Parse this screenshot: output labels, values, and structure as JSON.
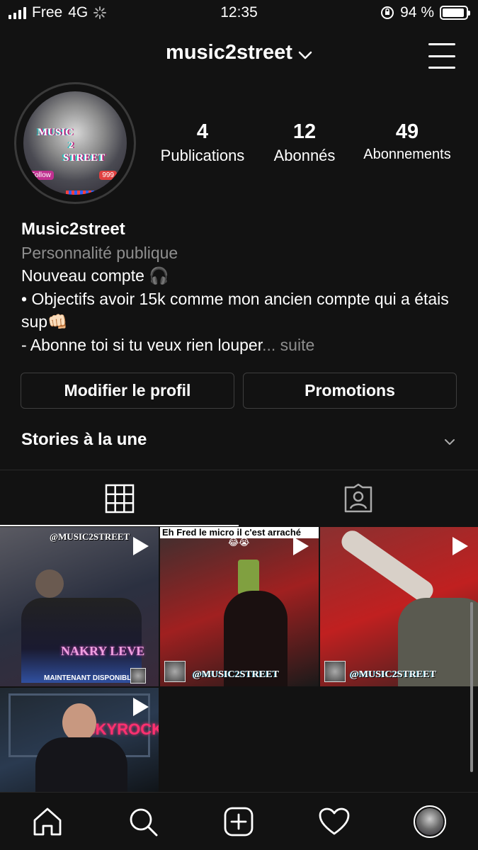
{
  "status_bar": {
    "carrier": "Free",
    "network": "4G",
    "time": "12:35",
    "battery_pct_text": "94 %",
    "battery_level": 0.94
  },
  "header": {
    "username": "music2street"
  },
  "profile": {
    "avatar_text": [
      "MUSIC",
      "2",
      "STREET"
    ],
    "avatar_badges": [
      "Follow",
      "999"
    ],
    "stats": [
      {
        "value": "4",
        "label": "Publications"
      },
      {
        "value": "12",
        "label": "Abonnés"
      },
      {
        "value": "49",
        "label": "Abonnements"
      }
    ],
    "display_name": "Music2street",
    "category": "Personnalité publique",
    "bio_lines": [
      "Nouveau compte 🎧",
      "• Objectifs avoir 15k comme mon ancien compte qui a étais sup👊🏻",
      "- Abonne toi si tu veux rien louper"
    ],
    "bio_more": "... suite"
  },
  "buttons": {
    "edit_profile": "Modifier le profil",
    "promotions": "Promotions"
  },
  "highlights": {
    "title": "Stories à la une"
  },
  "posts": [
    {
      "caption_top": "@MUSIC2STREET",
      "caption_bottom": "NAKRY LEVE",
      "sub": "MAINTENANT DISPONIBLE",
      "colors": [
        "#5a5a62",
        "#2b3040",
        "#3a2a3a"
      ]
    },
    {
      "caption_top": "Eh Fred le micro il c'est arraché",
      "emoji": "😂😭",
      "watermark": "@MUSIC2STREET",
      "colors": [
        "#3a3030",
        "#a02020",
        "#1a1a1a"
      ]
    },
    {
      "watermark": "@MUSIC2STREET",
      "colors": [
        "#8a3030",
        "#c02020",
        "#3a2020"
      ]
    },
    {
      "caption_top": "SKYROCK",
      "colors": [
        "#202830",
        "#2a3a50",
        "#101418"
      ]
    }
  ],
  "colors": {
    "background": "#121212",
    "text": "#ffffff",
    "secondary": "#8e8e8e",
    "border": "#3e3e3e"
  }
}
